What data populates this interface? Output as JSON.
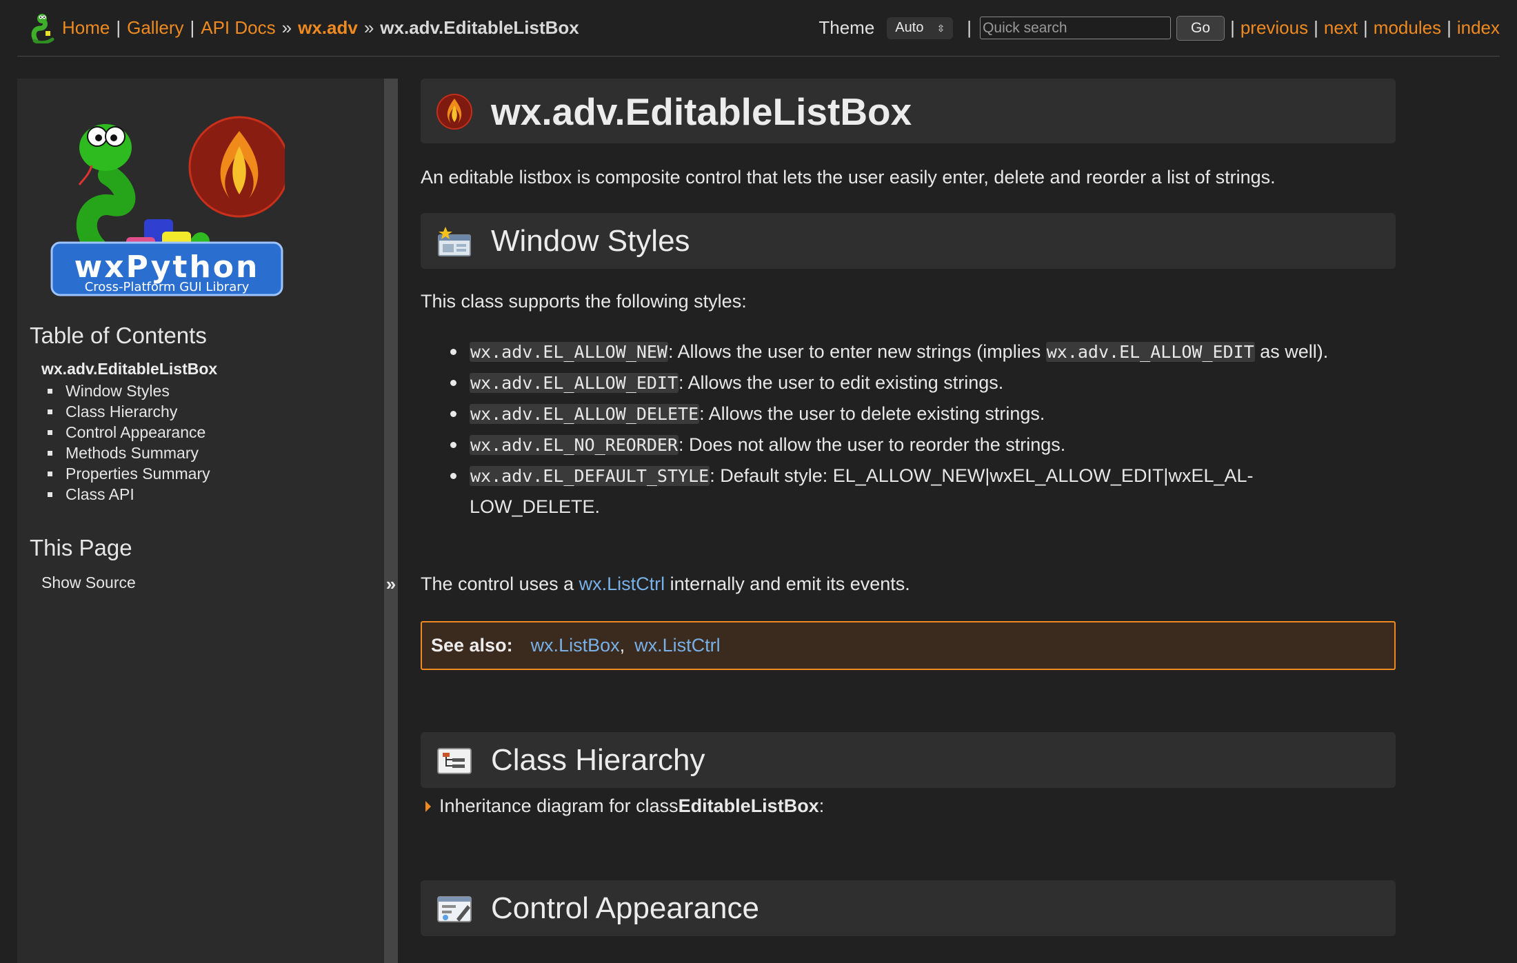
{
  "topbar": {
    "home": "Home",
    "gallery": "Gallery",
    "api_docs": "API Docs",
    "sep_pipe": "|",
    "sep_arrow": "»",
    "module": "wx.adv",
    "current": "wx.adv.EditableListBox",
    "theme_label": "Theme",
    "theme_value": "Auto",
    "search_placeholder": "Quick search",
    "go": "Go",
    "previous": "previous",
    "next": "next",
    "modules": "modules",
    "index": "index"
  },
  "sidebar": {
    "logo_title": "wxPython",
    "logo_subtitle": "Cross-Platform GUI Library",
    "toc_heading": "Table of Contents",
    "toc_root": "wx.adv.EditableListBox",
    "toc_items": [
      "Window Styles",
      "Class Hierarchy",
      "Control Appearance",
      "Methods Summary",
      "Properties Summary",
      "Class API"
    ],
    "this_page_heading": "This Page",
    "show_source": "Show Source",
    "collapse_glyph": "»"
  },
  "main": {
    "title": "wx.adv.EditableListBox",
    "intro": "An editable listbox is composite control that lets the user easily enter, delete and reorder a list of strings.",
    "window_styles_heading": "Window Styles",
    "styles_intro": "This class supports the following styles:",
    "styles": [
      {
        "code": "wx.adv.EL_ALLOW_NEW",
        "text_a": ": Allows the user to enter new strings (implies ",
        "code2": "wx.adv.EL_ALLOW_EDIT",
        "text_b": " as well)."
      },
      {
        "code": "wx.adv.EL_ALLOW_EDIT",
        "text": ": Allows the user to edit existing strings."
      },
      {
        "code": "wx.adv.EL_ALLOW_DELETE",
        "text": ": Allows the user to delete existing strings."
      },
      {
        "code": "wx.adv.EL_NO_REORDER",
        "text": ": Does not allow the user to reorder the strings."
      },
      {
        "code": "wx.adv.EL_DEFAULT_STYLE",
        "text_a": ": Default style: EL_ALLOW_NEW|wxEL_ALLOW_EDIT|wxEL_AL-",
        "text_b": "LOW_DELETE."
      }
    ],
    "control_text_a": "The control uses a ",
    "control_link": "wx.ListCtrl",
    "control_text_b": " internally and emit its events.",
    "see_also_label": "See also:",
    "see_also_link1": "wx.ListBox",
    "see_also_comma": ",",
    "see_also_link2": "wx.ListCtrl",
    "class_hierarchy_heading": "Class Hierarchy",
    "inherit_text_a": "Inheritance diagram for class ",
    "inherit_class": "EditableListBox",
    "inherit_text_b": ":",
    "control_appearance_heading": "Control Appearance"
  },
  "colors": {
    "accent": "#ef8a21",
    "link_blue": "#78b1e8",
    "background": "#212121",
    "sidebar": "#2b2b2b"
  },
  "icons": [
    "snake-mascot-icon",
    "phoenix-icon",
    "window-styles-icon",
    "class-hierarchy-icon",
    "control-appearance-icon"
  ]
}
